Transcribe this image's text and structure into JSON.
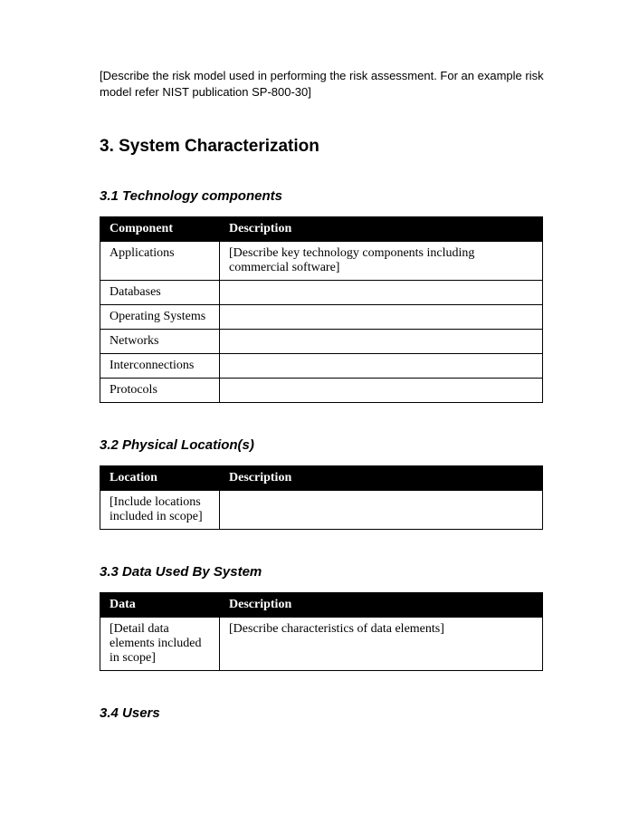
{
  "intro": "[Describe the risk model used in performing the risk assessment. For an example risk model refer NIST publication SP-800-30]",
  "section": {
    "heading": "3. System Characterization"
  },
  "sub31": {
    "heading": "3.1 Technology components",
    "headers": {
      "col1": "Component",
      "col2": "Description"
    },
    "rows": [
      {
        "c1": "Applications",
        "c2": "[Describe key technology components including commercial software]"
      },
      {
        "c1": "Databases",
        "c2": ""
      },
      {
        "c1": "Operating Systems",
        "c2": ""
      },
      {
        "c1": "Networks",
        "c2": ""
      },
      {
        "c1": "Interconnections",
        "c2": ""
      },
      {
        "c1": "Protocols",
        "c2": ""
      }
    ]
  },
  "sub32": {
    "heading": "3.2 Physical Location(s)",
    "headers": {
      "col1": "Location",
      "col2": "Description"
    },
    "rows": [
      {
        "c1": "[Include locations included in scope]",
        "c2": ""
      }
    ]
  },
  "sub33": {
    "heading": "3.3 Data Used By System",
    "headers": {
      "col1": "Data",
      "col2": "Description"
    },
    "rows": [
      {
        "c1": "[Detail data elements included in scope]",
        "c2": "[Describe characteristics of data elements]"
      }
    ]
  },
  "sub34": {
    "heading": "3.4 Users"
  }
}
